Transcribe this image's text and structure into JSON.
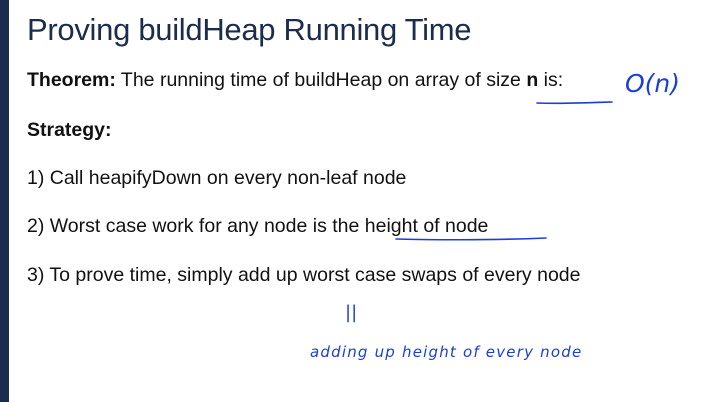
{
  "slide": {
    "title": "Proving buildHeap Running Time",
    "theorem": {
      "label": "Theorem:",
      "text_before": " The running time of buildHeap on array of size ",
      "n": "n",
      "text_after": " is:"
    },
    "strategy_label": "Strategy:",
    "steps": [
      "1) Call heapifyDown on every non-leaf node",
      "2) Worst case work for any node is the height of node",
      "3) To prove time, simply add up worst case swaps of every node"
    ]
  },
  "annotations": {
    "ink_color": "#1a3fd6",
    "big_o": "O(n)",
    "equals_mark": "||",
    "note": "adding up height of every node"
  },
  "colors": {
    "title": "#1c2c4c",
    "left_bar": "#1c2c4c",
    "text": "#111111"
  }
}
